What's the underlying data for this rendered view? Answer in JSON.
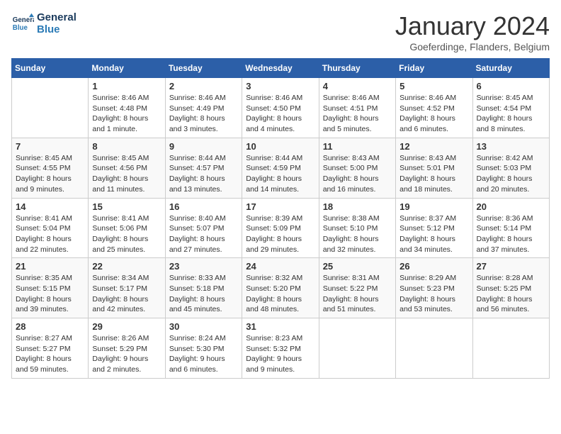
{
  "header": {
    "logo_line1": "General",
    "logo_line2": "Blue",
    "month_title": "January 2024",
    "location": "Goeferdinge, Flanders, Belgium"
  },
  "days_of_week": [
    "Sunday",
    "Monday",
    "Tuesday",
    "Wednesday",
    "Thursday",
    "Friday",
    "Saturday"
  ],
  "weeks": [
    [
      {
        "day": "",
        "content": ""
      },
      {
        "day": "1",
        "content": "Sunrise: 8:46 AM\nSunset: 4:48 PM\nDaylight: 8 hours\nand 1 minute."
      },
      {
        "day": "2",
        "content": "Sunrise: 8:46 AM\nSunset: 4:49 PM\nDaylight: 8 hours\nand 3 minutes."
      },
      {
        "day": "3",
        "content": "Sunrise: 8:46 AM\nSunset: 4:50 PM\nDaylight: 8 hours\nand 4 minutes."
      },
      {
        "day": "4",
        "content": "Sunrise: 8:46 AM\nSunset: 4:51 PM\nDaylight: 8 hours\nand 5 minutes."
      },
      {
        "day": "5",
        "content": "Sunrise: 8:46 AM\nSunset: 4:52 PM\nDaylight: 8 hours\nand 6 minutes."
      },
      {
        "day": "6",
        "content": "Sunrise: 8:45 AM\nSunset: 4:54 PM\nDaylight: 8 hours\nand 8 minutes."
      }
    ],
    [
      {
        "day": "7",
        "content": "Sunrise: 8:45 AM\nSunset: 4:55 PM\nDaylight: 8 hours\nand 9 minutes."
      },
      {
        "day": "8",
        "content": "Sunrise: 8:45 AM\nSunset: 4:56 PM\nDaylight: 8 hours\nand 11 minutes."
      },
      {
        "day": "9",
        "content": "Sunrise: 8:44 AM\nSunset: 4:57 PM\nDaylight: 8 hours\nand 13 minutes."
      },
      {
        "day": "10",
        "content": "Sunrise: 8:44 AM\nSunset: 4:59 PM\nDaylight: 8 hours\nand 14 minutes."
      },
      {
        "day": "11",
        "content": "Sunrise: 8:43 AM\nSunset: 5:00 PM\nDaylight: 8 hours\nand 16 minutes."
      },
      {
        "day": "12",
        "content": "Sunrise: 8:43 AM\nSunset: 5:01 PM\nDaylight: 8 hours\nand 18 minutes."
      },
      {
        "day": "13",
        "content": "Sunrise: 8:42 AM\nSunset: 5:03 PM\nDaylight: 8 hours\nand 20 minutes."
      }
    ],
    [
      {
        "day": "14",
        "content": "Sunrise: 8:41 AM\nSunset: 5:04 PM\nDaylight: 8 hours\nand 22 minutes."
      },
      {
        "day": "15",
        "content": "Sunrise: 8:41 AM\nSunset: 5:06 PM\nDaylight: 8 hours\nand 25 minutes."
      },
      {
        "day": "16",
        "content": "Sunrise: 8:40 AM\nSunset: 5:07 PM\nDaylight: 8 hours\nand 27 minutes."
      },
      {
        "day": "17",
        "content": "Sunrise: 8:39 AM\nSunset: 5:09 PM\nDaylight: 8 hours\nand 29 minutes."
      },
      {
        "day": "18",
        "content": "Sunrise: 8:38 AM\nSunset: 5:10 PM\nDaylight: 8 hours\nand 32 minutes."
      },
      {
        "day": "19",
        "content": "Sunrise: 8:37 AM\nSunset: 5:12 PM\nDaylight: 8 hours\nand 34 minutes."
      },
      {
        "day": "20",
        "content": "Sunrise: 8:36 AM\nSunset: 5:14 PM\nDaylight: 8 hours\nand 37 minutes."
      }
    ],
    [
      {
        "day": "21",
        "content": "Sunrise: 8:35 AM\nSunset: 5:15 PM\nDaylight: 8 hours\nand 39 minutes."
      },
      {
        "day": "22",
        "content": "Sunrise: 8:34 AM\nSunset: 5:17 PM\nDaylight: 8 hours\nand 42 minutes."
      },
      {
        "day": "23",
        "content": "Sunrise: 8:33 AM\nSunset: 5:18 PM\nDaylight: 8 hours\nand 45 minutes."
      },
      {
        "day": "24",
        "content": "Sunrise: 8:32 AM\nSunset: 5:20 PM\nDaylight: 8 hours\nand 48 minutes."
      },
      {
        "day": "25",
        "content": "Sunrise: 8:31 AM\nSunset: 5:22 PM\nDaylight: 8 hours\nand 51 minutes."
      },
      {
        "day": "26",
        "content": "Sunrise: 8:29 AM\nSunset: 5:23 PM\nDaylight: 8 hours\nand 53 minutes."
      },
      {
        "day": "27",
        "content": "Sunrise: 8:28 AM\nSunset: 5:25 PM\nDaylight: 8 hours\nand 56 minutes."
      }
    ],
    [
      {
        "day": "28",
        "content": "Sunrise: 8:27 AM\nSunset: 5:27 PM\nDaylight: 8 hours\nand 59 minutes."
      },
      {
        "day": "29",
        "content": "Sunrise: 8:26 AM\nSunset: 5:29 PM\nDaylight: 9 hours\nand 2 minutes."
      },
      {
        "day": "30",
        "content": "Sunrise: 8:24 AM\nSunset: 5:30 PM\nDaylight: 9 hours\nand 6 minutes."
      },
      {
        "day": "31",
        "content": "Sunrise: 8:23 AM\nSunset: 5:32 PM\nDaylight: 9 hours\nand 9 minutes."
      },
      {
        "day": "",
        "content": ""
      },
      {
        "day": "",
        "content": ""
      },
      {
        "day": "",
        "content": ""
      }
    ]
  ]
}
